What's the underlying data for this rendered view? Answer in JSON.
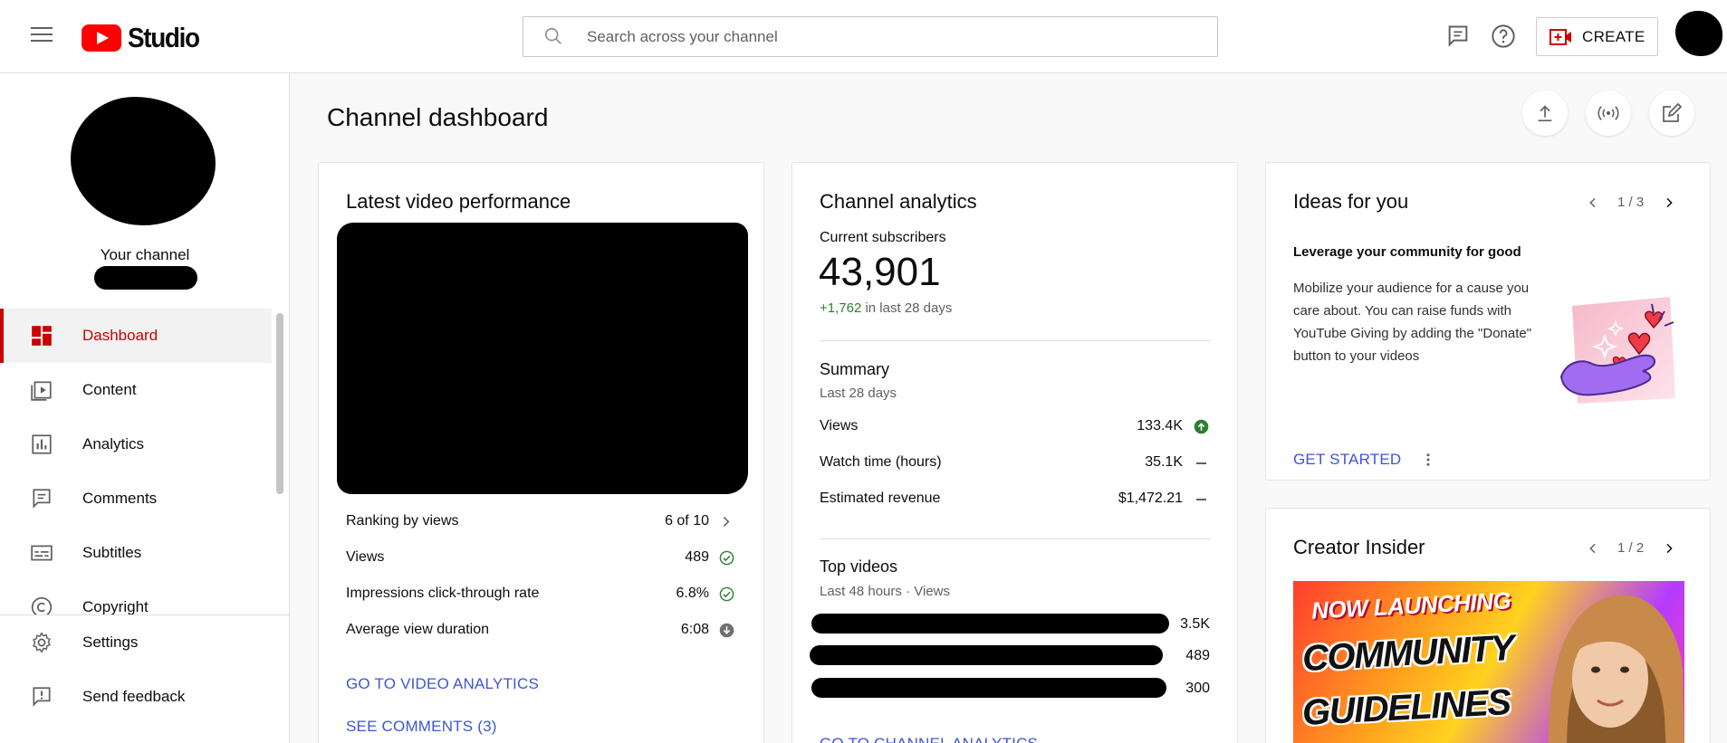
{
  "topbar": {
    "logo_text": "Studio",
    "search_placeholder": "Search across your channel",
    "create_label": "CREATE"
  },
  "sidebar": {
    "channel_label": "Your channel",
    "items": [
      {
        "label": "Dashboard"
      },
      {
        "label": "Content"
      },
      {
        "label": "Analytics"
      },
      {
        "label": "Comments"
      },
      {
        "label": "Subtitles"
      },
      {
        "label": "Copyright"
      }
    ],
    "bottom_items": [
      {
        "label": "Settings"
      },
      {
        "label": "Send feedback"
      }
    ]
  },
  "main": {
    "title": "Channel dashboard"
  },
  "latest_video": {
    "title": "Latest video performance",
    "rows": [
      {
        "label": "Ranking by views",
        "value": "6 of 10"
      },
      {
        "label": "Views",
        "value": "489"
      },
      {
        "label": "Impressions click-through rate",
        "value": "6.8%"
      },
      {
        "label": "Average view duration",
        "value": "6:08"
      }
    ],
    "link_analytics": "GO TO VIDEO ANALYTICS",
    "link_comments": "SEE COMMENTS (3)"
  },
  "channel_analytics": {
    "title": "Channel analytics",
    "subs_label": "Current subscribers",
    "subs_value": "43,901",
    "subs_delta": "+1,762",
    "subs_delta_suffix": " in last 28 days",
    "summary_title": "Summary",
    "summary_period": "Last 28 days",
    "summary_rows": [
      {
        "label": "Views",
        "value": "133.4K"
      },
      {
        "label": "Watch time (hours)",
        "value": "35.1K"
      },
      {
        "label": "Estimated revenue",
        "value": "$1,472.21"
      }
    ],
    "top_title": "Top videos",
    "top_period": "Last 48 hours · Views",
    "top_values": [
      "3.5K",
      "489",
      "300"
    ],
    "link": "GO TO CHANNEL ANALYTICS"
  },
  "ideas": {
    "title": "Ideas for you",
    "pager": "1 / 3",
    "headline": "Leverage your community for good",
    "body": "Mobilize your audience for a cause you care about. You can raise funds with YouTube Giving by adding the \"Donate\" button to your videos",
    "cta": "GET STARTED"
  },
  "creator_insider": {
    "title": "Creator Insider",
    "pager": "1 / 2",
    "thumb_line1": "NOW LAUNCHING",
    "thumb_line2": "COMMUNITY",
    "thumb_line3": "GUIDELINES"
  },
  "colors": {
    "accent_red": "#cc0000",
    "link_blue": "#3e55d6",
    "positive_green": "#2e7d32"
  }
}
